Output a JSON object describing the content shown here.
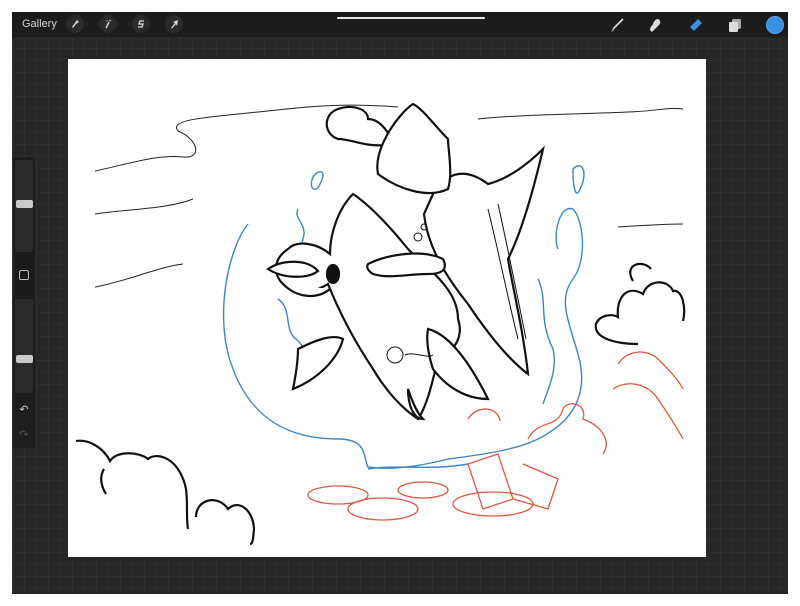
{
  "topbar": {
    "gallery_label": "Gallery",
    "left_tools": [
      {
        "name": "actions",
        "icon": "wrench-icon"
      },
      {
        "name": "adjustments",
        "icon": "magic-wand-icon"
      },
      {
        "name": "selection",
        "icon": "selection-s-icon"
      },
      {
        "name": "transform",
        "icon": "arrow-cursor-icon"
      }
    ],
    "right_tools": [
      {
        "name": "brush",
        "icon": "brush-icon"
      },
      {
        "name": "smudge",
        "icon": "smudge-icon"
      },
      {
        "name": "eraser",
        "icon": "eraser-icon",
        "active": true
      },
      {
        "name": "layers",
        "icon": "layers-icon"
      }
    ],
    "current_color": "#3d8fe0"
  },
  "sidebar": {
    "brush_size_fraction": 0.7,
    "opacity_fraction": 0.2,
    "modify_icon": "square-icon",
    "undo_icon": "undo-icon",
    "redo_icon": "redo-icon"
  },
  "colors": {
    "ink": "#111111",
    "blue_sketch": "#3b86c8",
    "red_sketch": "#e2553f",
    "accent": "#3d8fe0"
  }
}
